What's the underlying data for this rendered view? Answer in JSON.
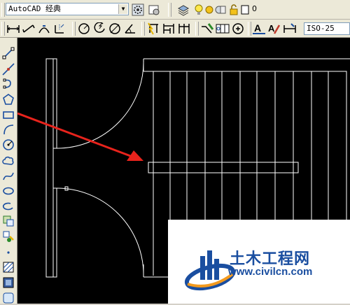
{
  "toolbar_top": {
    "workspace": "AutoCAD 经典",
    "layer_name": "0"
  },
  "toolbar_dim": {
    "dimstyle": "ISO-25"
  },
  "icons": {
    "workspace_settings": "gear-icon",
    "layers": "layers-icon",
    "draw_line": "line-icon",
    "draw_rect": "rectangle-icon"
  },
  "colors": {
    "canvas": "#000000",
    "drawing_lines": "#ffffff",
    "annotation_arrow": "#e8231c",
    "watermark_blue": "#1a4ea0",
    "watermark_orange": "#f39a1e"
  },
  "watermark": {
    "brand": "土木工程网",
    "url": "www.civilcn.com"
  }
}
